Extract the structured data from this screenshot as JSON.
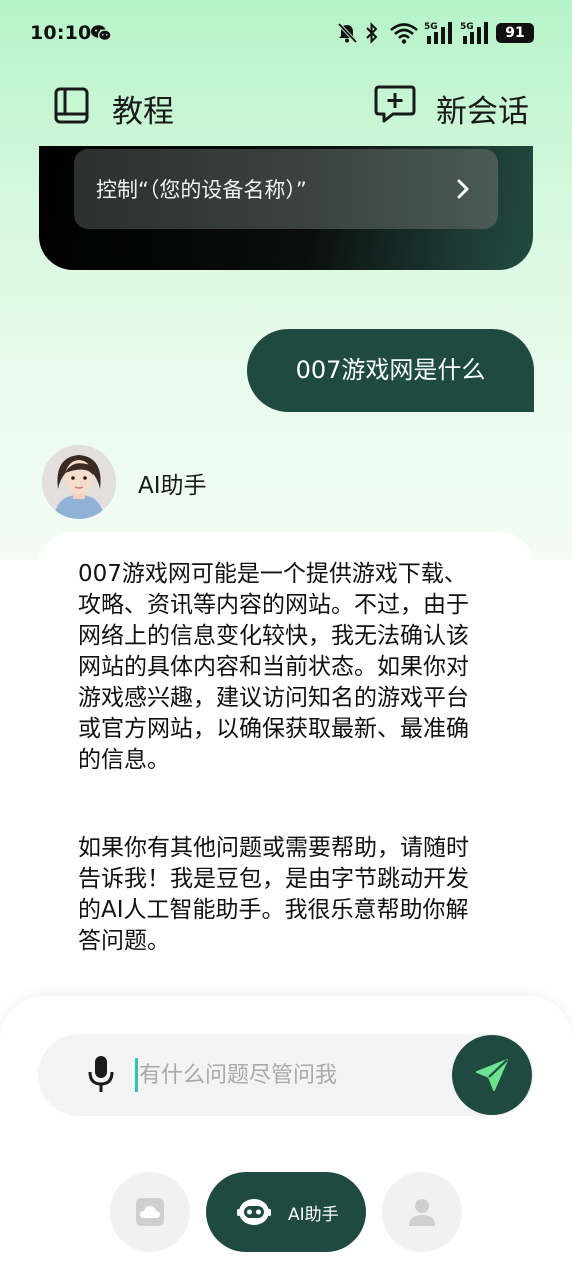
{
  "status_bar": {
    "time": "10:10",
    "battery": "91",
    "signal_1_label": "5G",
    "signal_2_label": "5G",
    "icons": [
      "wechat-icon",
      "mute-icon",
      "bluetooth-icon",
      "wifi-icon",
      "signal-icon",
      "signal-icon",
      "battery-icon"
    ]
  },
  "header": {
    "tutorial_label": "教程",
    "new_chat_label": "新会话",
    "icons": [
      "book-icon",
      "new-chat-icon"
    ]
  },
  "control_card": {
    "item_label": "控制“（您的设备名称）”"
  },
  "chat": {
    "user_message": "007游戏网是什么",
    "assistant_name": "AI助手",
    "assistant_reply_p1": "007游戏网可能是一个提供游戏下载、攻略、资讯等内容的网站。不过，由于网络上的信息变化较快，我无法确认该网站的具体内容和当前状态。如果你对游戏感兴趣，建议访问知名的游戏平台或官方网站，以确保获取最新、最准确的信息。",
    "assistant_reply_p2": "如果你有其他问题或需要帮助，请随时告诉我！我是豆包，是由字节跳动开发的AI人工智能助手。我很乐意帮助你解答问题。"
  },
  "composer": {
    "placeholder": "有什么问题尽管问我",
    "value": ""
  },
  "bottom_nav": {
    "ai_label": "AI助手",
    "icons": [
      "cloud-icon",
      "robot-icon",
      "person-icon"
    ]
  },
  "colors": {
    "accent": "#1e4a3f",
    "bg_top": "#b6f3c8",
    "caret": "#31c2b6"
  }
}
